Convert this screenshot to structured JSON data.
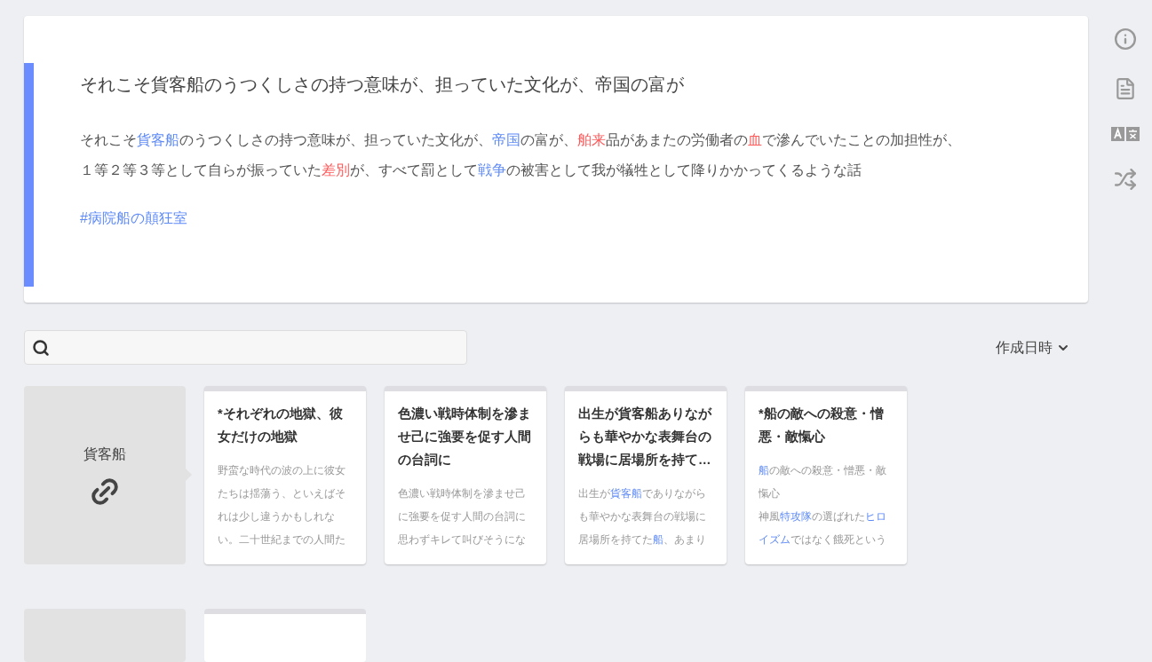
{
  "page": {
    "title": "それこそ貨客船のうつくしさの持つ意味が、担っていた文化が、帝国の富が",
    "paragraph": [
      {
        "kind": "text",
        "text": "それこそ"
      },
      {
        "kind": "link",
        "text": "貨客船"
      },
      {
        "kind": "text",
        "text": "のうつくしさの持つ意味が、担っていた文化が、"
      },
      {
        "kind": "link",
        "text": "帝国"
      },
      {
        "kind": "text",
        "text": "の富が、"
      },
      {
        "kind": "missing-link",
        "text": "舶来"
      },
      {
        "kind": "text",
        "text": "品があまたの労働者の"
      },
      {
        "kind": "missing-link",
        "text": "血"
      },
      {
        "kind": "text",
        "text": "で滲んでいたことの加担性が、１等２等３等として自らが振っていた"
      },
      {
        "kind": "missing-link",
        "text": "差別"
      },
      {
        "kind": "text",
        "text": "が、すべて罰として"
      },
      {
        "kind": "link",
        "text": "戦争"
      },
      {
        "kind": "text",
        "text": "の被害として我が犠牲として降りかかってくるような話"
      }
    ],
    "hashtag": "#病院船の顛狂室"
  },
  "sort": {
    "label": "作成日時"
  },
  "related": {
    "title": "貨客船",
    "cards": [
      {
        "title": "*それぞれの地獄、彼女だけの地獄",
        "description": [
          {
            "kind": "text",
            "text": "野蛮な時代の波の上に彼女たちは揺蕩う、といえばそれは少し違うかもしれない。二十世紀までの人間た"
          }
        ]
      },
      {
        "title": "色濃い戦時体制を滲ませ己に強要を促す人間の台詞に",
        "description": [
          {
            "kind": "text",
            "text": "色濃い戦時体制を滲ませ己に強要を促す人間の台詞に思わずキレて叫びそうにな"
          }
        ]
      },
      {
        "title": "出生が貨客船ありながらも華やかな表舞台の戦場に居場所を持て…",
        "description": [
          {
            "kind": "text",
            "text": "出生が"
          },
          {
            "kind": "link",
            "text": "貨客船"
          },
          {
            "kind": "text",
            "text": "でありながらも華やかな表舞台の戦場に居場所を持てた"
          },
          {
            "kind": "link",
            "text": "船"
          },
          {
            "kind": "text",
            "text": "、あまり"
          }
        ]
      },
      {
        "title": "*船の敵への殺意・憎悪・敵愾心",
        "description": [
          {
            "kind": "link",
            "text": "船"
          },
          {
            "kind": "text",
            "text": "の敵への殺意・憎悪・敵愾心"
          },
          {
            "kind": "break"
          },
          {
            "kind": "text",
            "text": "神風"
          },
          {
            "kind": "link",
            "text": "特攻隊"
          },
          {
            "kind": "text",
            "text": "の選ばれた"
          },
          {
            "kind": "link",
            "text": "ヒロイズム"
          },
          {
            "kind": "text",
            "text": "ではなく餓死という"
          }
        ]
      }
    ]
  }
}
